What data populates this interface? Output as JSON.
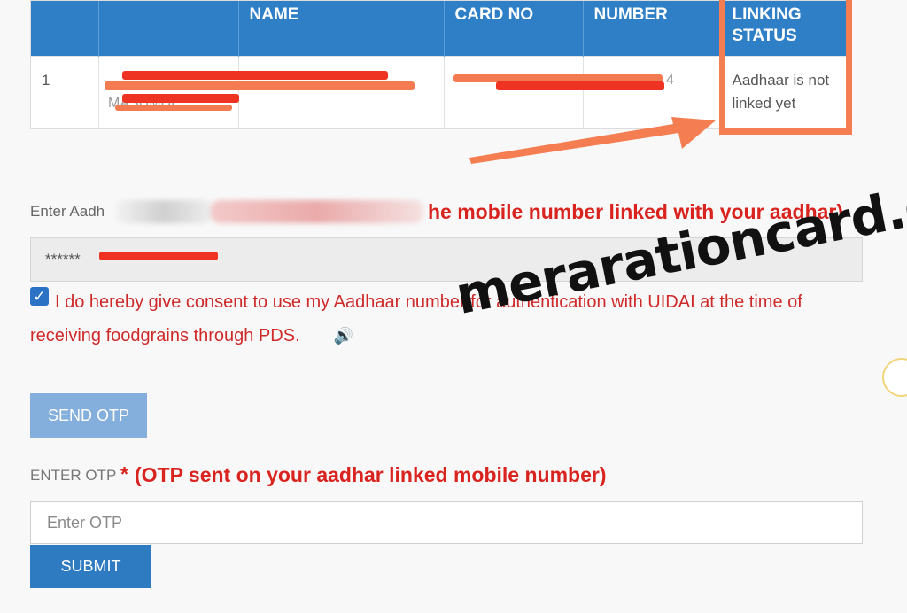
{
  "table": {
    "headers": [
      "",
      "",
      "NAME",
      "CARD NO",
      "NUMBER",
      "LINKING STATUS"
    ],
    "row": {
      "sno": "1",
      "status": "Aadhaar is not linked yet"
    },
    "faded_fragments": {
      "name_fragment": "MASUMDE",
      "number_fragment": "4"
    }
  },
  "aadhaar": {
    "label_prefix": "Enter Aadh",
    "hint": "he mobile number linked with your aadhar)",
    "input_value": "******"
  },
  "consent": {
    "checked": true,
    "text": "I do hereby give consent to use my Aadhaar number for authentication with UIDAI at the time of receiving foodgrains through PDS."
  },
  "watermark": "merarationcard.com",
  "buttons": {
    "send_otp": "SEND OTP",
    "submit": "SUBMIT"
  },
  "otp": {
    "label": "ENTER OTP",
    "required_mark": "*",
    "hint": "(OTP sent on your aadhar linked mobile number)",
    "placeholder": "Enter OTP"
  },
  "colors": {
    "header_blue": "#2f7fc7",
    "highlight_orange": "#f47e52",
    "hint_red": "#d9231f",
    "redact_red": "#ee3322"
  },
  "icons": {
    "speaker": "speaker-icon",
    "check": "checkmark-icon"
  }
}
